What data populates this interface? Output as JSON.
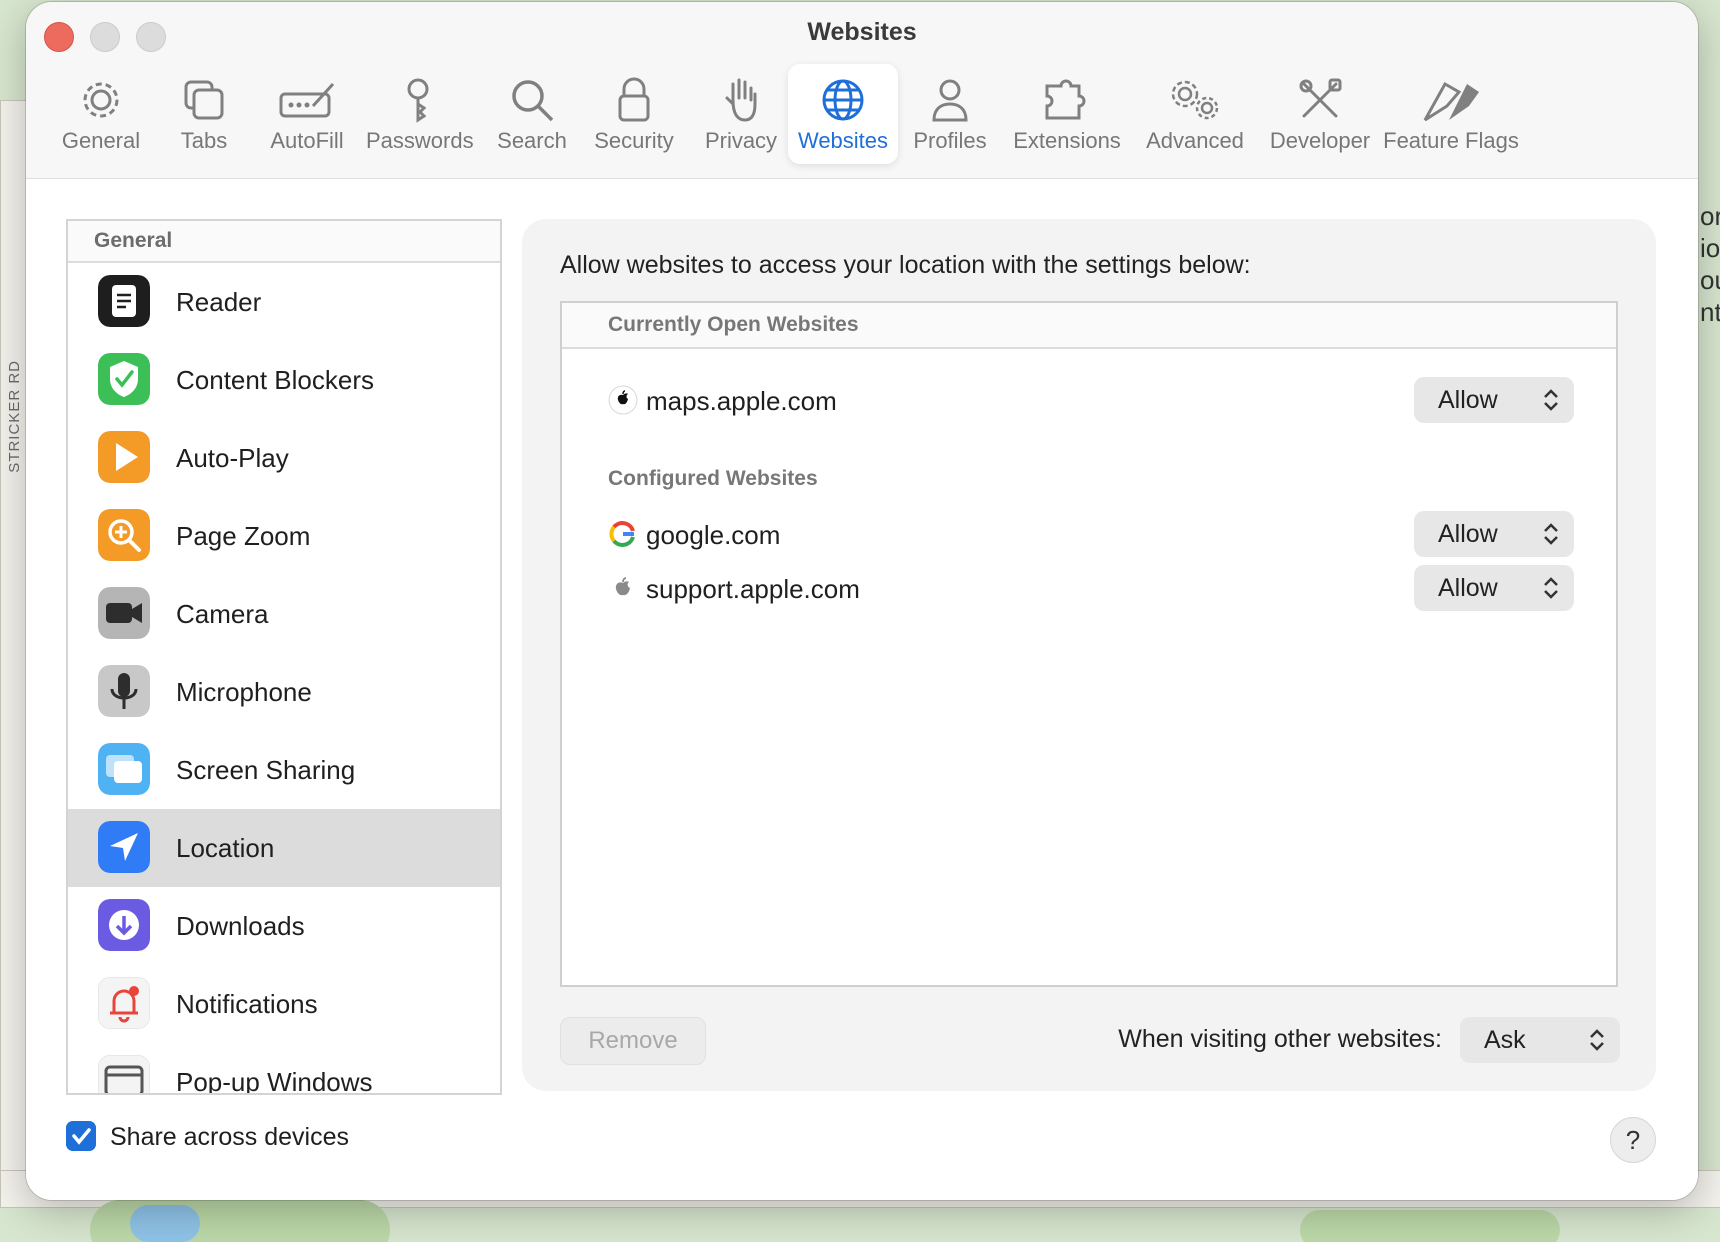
{
  "window": {
    "title": "Websites"
  },
  "toolbar": {
    "items": [
      {
        "label": "General",
        "icon": "gear-icon"
      },
      {
        "label": "Tabs",
        "icon": "tabs-icon"
      },
      {
        "label": "AutoFill",
        "icon": "autofill-icon"
      },
      {
        "label": "Passwords",
        "icon": "key-icon"
      },
      {
        "label": "Search",
        "icon": "search-icon"
      },
      {
        "label": "Security",
        "icon": "lock-icon"
      },
      {
        "label": "Privacy",
        "icon": "hand-icon"
      },
      {
        "label": "Websites",
        "icon": "globe-icon",
        "selected": true
      },
      {
        "label": "Profiles",
        "icon": "person-icon"
      },
      {
        "label": "Extensions",
        "icon": "puzzle-icon"
      },
      {
        "label": "Advanced",
        "icon": "gears-icon"
      },
      {
        "label": "Developer",
        "icon": "tools-icon"
      },
      {
        "label": "Feature Flags",
        "icon": "flags-icon"
      }
    ]
  },
  "sidebar": {
    "header": "General",
    "items": [
      {
        "label": "Reader",
        "icon": "reader-icon"
      },
      {
        "label": "Content Blockers",
        "icon": "shield-check-icon"
      },
      {
        "label": "Auto-Play",
        "icon": "play-icon"
      },
      {
        "label": "Page Zoom",
        "icon": "zoom-icon"
      },
      {
        "label": "Camera",
        "icon": "camera-icon"
      },
      {
        "label": "Microphone",
        "icon": "microphone-icon"
      },
      {
        "label": "Screen Sharing",
        "icon": "screen-sharing-icon"
      },
      {
        "label": "Location",
        "icon": "location-arrow-icon",
        "selected": true
      },
      {
        "label": "Downloads",
        "icon": "download-icon"
      },
      {
        "label": "Notifications",
        "icon": "bell-icon"
      },
      {
        "label": "Pop-up Windows",
        "icon": "popup-window-icon"
      }
    ]
  },
  "panel": {
    "intro": "Allow websites to access your location with the settings below:",
    "open_header": "Currently Open Websites",
    "open_sites": [
      {
        "domain": "maps.apple.com",
        "setting": "Allow",
        "favicon": "apple-logo-icon"
      }
    ],
    "configured_header": "Configured Websites",
    "configured_sites": [
      {
        "domain": "google.com",
        "setting": "Allow",
        "favicon": "google-logo-icon"
      },
      {
        "domain": "support.apple.com",
        "setting": "Allow",
        "favicon": "apple-logo-icon"
      }
    ],
    "remove_label": "Remove",
    "other_label": "When visiting other websites:",
    "other_value": "Ask"
  },
  "footer": {
    "share_label": "Share across devices",
    "share_checked": true,
    "help_label": "?"
  },
  "background": {
    "street_label": "STRICKER RD",
    "edge_text": [
      "or",
      "io",
      "ou",
      "nt"
    ]
  },
  "colors": {
    "accent": "#1f6fd8",
    "close": "#ed6a5e"
  }
}
